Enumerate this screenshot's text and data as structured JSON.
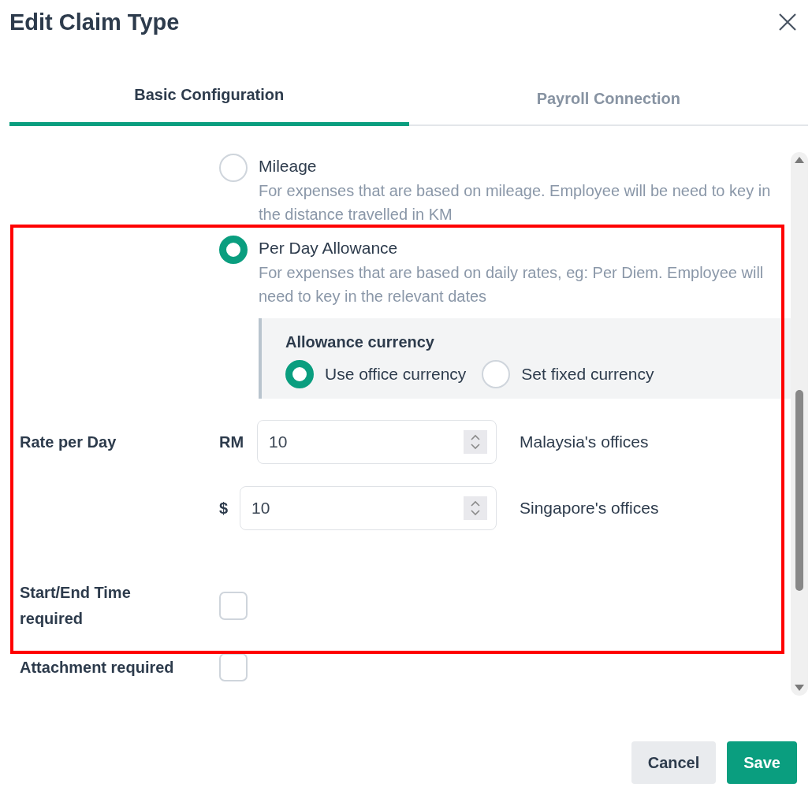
{
  "dialog": {
    "title": "Edit Claim Type"
  },
  "tabs": [
    {
      "label": "Basic Configuration",
      "selected": true
    },
    {
      "label": "Payroll Connection",
      "selected": false
    }
  ],
  "claim_kinds": [
    {
      "label": "Mileage",
      "description": "For expenses that are based on mileage. Employee will be need to key in the distance travelled in KM",
      "selected": false
    },
    {
      "label": "Per Day Allowance",
      "description": "For expenses that are based on daily rates, eg: Per Diem. Employee will need to key in the relevant dates",
      "selected": true
    }
  ],
  "allowance_currency": {
    "title": "Allowance currency",
    "options": [
      {
        "label": "Use office currency",
        "selected": true
      },
      {
        "label": "Set fixed currency",
        "selected": false
      }
    ]
  },
  "rate_per_day": {
    "label": "Rate per Day",
    "rates": [
      {
        "currency": "RM",
        "value": "10",
        "office": "Malaysia's offices"
      },
      {
        "currency": "$",
        "value": "10",
        "office": "Singapore's offices"
      }
    ]
  },
  "settings": [
    {
      "label": "Start/End Time required",
      "checked": false
    },
    {
      "label": "Attachment required",
      "checked": false
    }
  ],
  "buttons": [
    {
      "label": "Cancel",
      "kind": "secondary"
    },
    {
      "label": "Save",
      "kind": "primary"
    }
  ]
}
